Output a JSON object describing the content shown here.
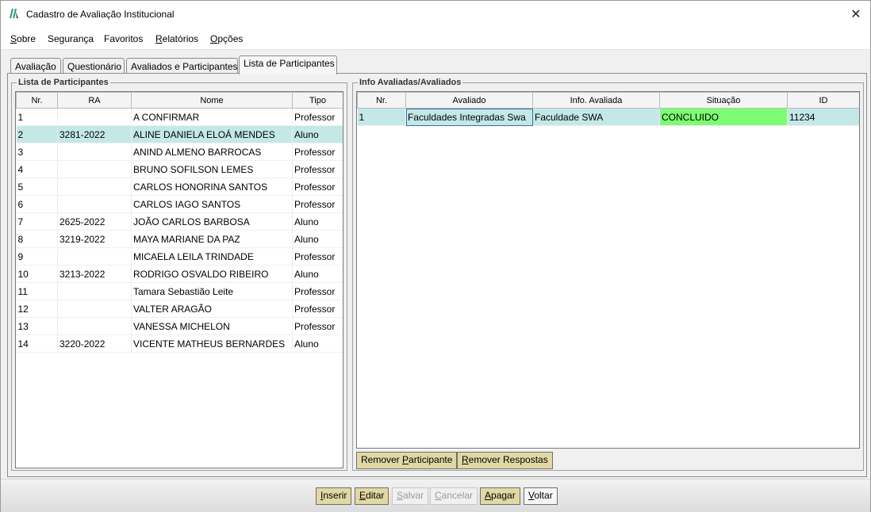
{
  "window": {
    "title": "Cadastro de Avaliação Institucional",
    "close_glyph": "✕"
  },
  "menu": [
    {
      "key": "S",
      "rest": "obre"
    },
    {
      "key": "",
      "rest": "Segurança"
    },
    {
      "key": "",
      "rest": "Favoritos"
    },
    {
      "key": "R",
      "rest": "elatórios"
    },
    {
      "key": "O",
      "rest": "pções"
    }
  ],
  "tabs": [
    "Avaliação",
    "Questionário",
    "Avaliados e Participantes",
    "Lista de Participantes"
  ],
  "participants": {
    "title": "Lista de Participantes",
    "columns": [
      "Nr.",
      "RA",
      "Nome",
      "Tipo"
    ],
    "rows": [
      [
        "1",
        "",
        "A CONFIRMAR",
        "Professor"
      ],
      [
        "2",
        "3281-2022",
        "ALINE DANIELA ELOÁ MENDES",
        "Aluno"
      ],
      [
        "3",
        "",
        "ANIND ALMENO BARROCAS",
        "Professor"
      ],
      [
        "4",
        "",
        "BRUNO SOFILSON LEMES",
        "Professor"
      ],
      [
        "5",
        "",
        "CARLOS HONORINA SANTOS",
        "Professor"
      ],
      [
        "6",
        "",
        "CARLOS IAGO SANTOS",
        "Professor"
      ],
      [
        "7",
        "2625-2022",
        "JOÃO CARLOS BARBOSA",
        "Aluno"
      ],
      [
        "8",
        "3219-2022",
        "MAYA MARIANE DA PAZ",
        "Aluno"
      ],
      [
        "9",
        "",
        "MICAELA LEILA TRINDADE",
        "Professor"
      ],
      [
        "10",
        "3213-2022",
        "RODRIGO OSVALDO RIBEIRO",
        "Aluno"
      ],
      [
        "11",
        "",
        "Tamara Sebastião Leite",
        "Professor"
      ],
      [
        "12",
        "",
        "VALTER ARAGÃO",
        "Professor"
      ],
      [
        "13",
        "",
        "VANESSA MICHELON",
        "Professor"
      ],
      [
        "14",
        "3220-2022",
        "VICENTE MATHEUS BERNARDES",
        "Aluno"
      ]
    ],
    "selected_row": 1
  },
  "evaluated": {
    "title": "Info Avaliadas/Avaliados",
    "columns": [
      "Nr.",
      "Avaliado",
      "Info. Avaliada",
      "Situação",
      "ID"
    ],
    "rows": [
      [
        "1",
        "Faculdades Integradas Swa",
        "Faculdade SWA",
        "CONCLUIDO",
        "11234"
      ]
    ],
    "status_color": "#7cfc72",
    "selected_color": "#c4e8e8"
  },
  "panel_buttons": {
    "remove_participant": {
      "pre": "Remover ",
      "key": "P",
      "post": "articipante"
    },
    "remove_answers": {
      "pre": "",
      "key": "R",
      "post": "emover Respostas"
    }
  },
  "bottom_buttons": {
    "insert": {
      "key": "I",
      "post": "nserir"
    },
    "edit": {
      "key": "E",
      "post": "ditar"
    },
    "save": {
      "key": "S",
      "post": "alvar"
    },
    "cancel": {
      "key": "C",
      "post": "ancelar"
    },
    "delete": {
      "key": "A",
      "post": "pagar"
    },
    "back": {
      "key": "V",
      "post": "oltar"
    }
  },
  "accent_colors": {
    "button": "#e1d8a4",
    "logo": "#1f9a82"
  }
}
